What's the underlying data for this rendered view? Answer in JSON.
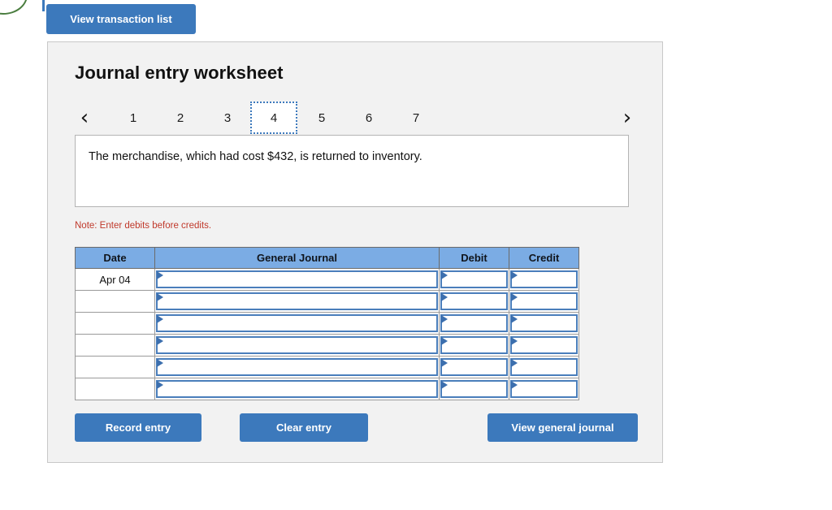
{
  "toolbar": {
    "view_transaction_label": "View transaction list"
  },
  "panel": {
    "title": "Journal entry worksheet",
    "pager": {
      "prev_icon": "chevron-left-icon",
      "next_icon": "chevron-right-icon",
      "prev_glyph": "‹",
      "next_glyph": "›",
      "pages": [
        "1",
        "2",
        "3",
        "4",
        "5",
        "6",
        "7"
      ],
      "active_page": "4"
    },
    "description": "The merchandise, which had cost $432, is returned to inventory.",
    "note": "Note: Enter debits before credits.",
    "table": {
      "headers": [
        "Date",
        "General Journal",
        "Debit",
        "Credit"
      ],
      "rows": [
        {
          "date": "Apr 04",
          "general_journal": "",
          "debit": "",
          "credit": ""
        },
        {
          "date": "",
          "general_journal": "",
          "debit": "",
          "credit": ""
        },
        {
          "date": "",
          "general_journal": "",
          "debit": "",
          "credit": ""
        },
        {
          "date": "",
          "general_journal": "",
          "debit": "",
          "credit": ""
        },
        {
          "date": "",
          "general_journal": "",
          "debit": "",
          "credit": ""
        },
        {
          "date": "",
          "general_journal": "",
          "debit": "",
          "credit": ""
        }
      ]
    },
    "actions": {
      "record_label": "Record entry",
      "clear_label": "Clear entry",
      "view_journal_label": "View general journal"
    }
  },
  "colors": {
    "button_blue": "#3c79bc",
    "header_blue": "#7bace4",
    "cell_border_blue": "#4a7ebb",
    "note_red": "#c0392b",
    "panel_bg": "#f2f2f2",
    "accent_green": "#4a7d3f"
  }
}
